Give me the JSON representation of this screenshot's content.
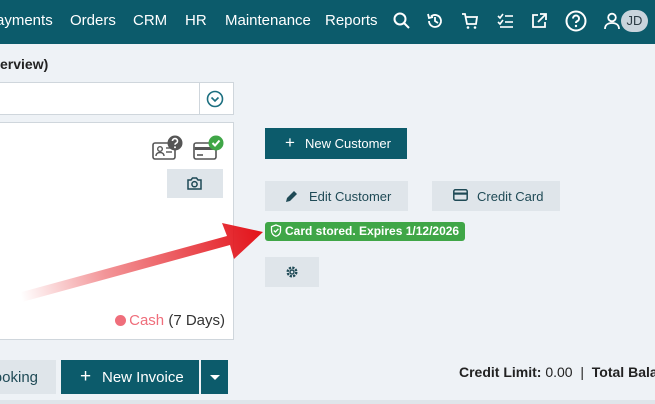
{
  "nav": {
    "links": [
      "ayments",
      "Orders",
      "CRM",
      "HR",
      "Maintenance",
      "Reports"
    ],
    "avatar_initials": "JD"
  },
  "page": {
    "heading": "erview)"
  },
  "customer_card": {
    "payment_method": "Cash",
    "payment_terms": " (7 Days)"
  },
  "actions": {
    "new_customer": "New Customer",
    "edit_customer": "Edit Customer",
    "credit_card": "Credit Card",
    "card_status": "Card stored. Expires 1/12/2026"
  },
  "bottom": {
    "booking": "ooking",
    "new_invoice": "New Invoice",
    "credit_limit_label": "Credit Limit:",
    "credit_limit_value": " 0.00",
    "separator": "|",
    "total_balance_label": "Total Bala"
  },
  "colors": {
    "nav_bg": "#0c5b6b",
    "primary": "#0c5b6b",
    "success": "#3fa647",
    "cash": "#ef6e7b",
    "arrow": "#e3131a"
  }
}
